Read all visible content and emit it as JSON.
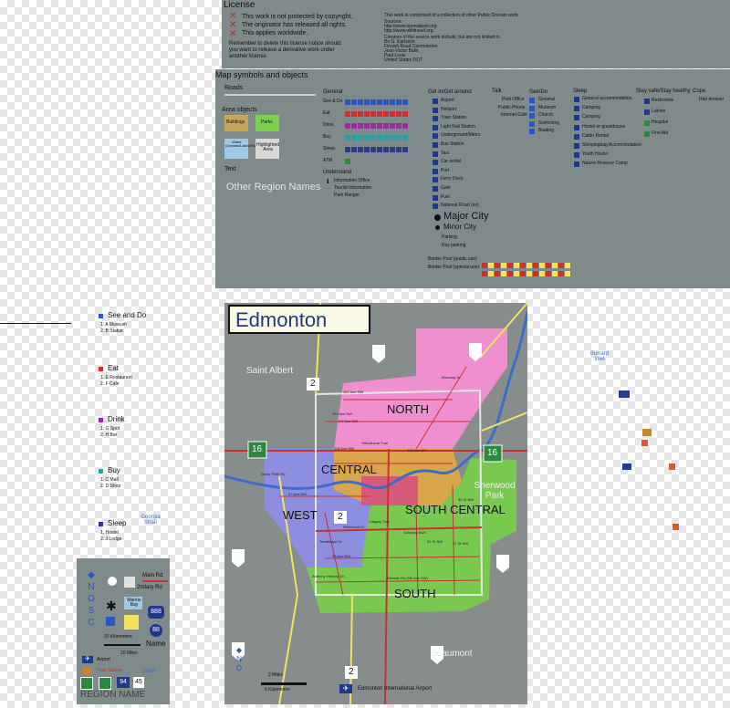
{
  "license": {
    "title": "License",
    "lines": [
      "This work is not protected by copyright.",
      "The originator has released all rights.",
      "This applies worldwide."
    ],
    "reminder": [
      "Remember to delete this license notice should",
      "you want to release a derivative work under",
      "another license."
    ],
    "credits": [
      "This work is comprised of a collection of other Public Domain work.",
      "Sources:",
      "http://www.openclipart.org",
      "http://www.wikitravel.org",
      "Creators of the source work include, but are not limited to",
      "Bo G. Karlsson",
      "Finnish Road Commission",
      "Jean-Victor Balin",
      "Paul Louis",
      "United States DOT"
    ]
  },
  "legend": {
    "title": "Map symbols and objects",
    "roads": "Roads",
    "area_objects": "Area objects",
    "areas": [
      {
        "label": "Buildings",
        "color": "#c8a35a"
      },
      {
        "label": "Parks",
        "color": "#7fd04a"
      },
      {
        "label": "Water (Oceans/Lakes/Rivers/Ponds)",
        "color": "#9ec8e6"
      },
      {
        "label": "Highlighted Area",
        "color": "#d8d8d8"
      }
    ],
    "text": "Text",
    "other_region": "Other Region Names",
    "general": {
      "title": "General",
      "rows": [
        {
          "label": "See & Do",
          "color": "#2a56c6",
          "count": 10
        },
        {
          "label": "Eat",
          "color": "#c83232",
          "count": 10
        },
        {
          "label": "Drink",
          "color": "#9b2c9b",
          "count": 10
        },
        {
          "label": "Buy",
          "color": "#2aa0a0",
          "count": 10
        },
        {
          "label": "Sleep",
          "color": "#2a3c8a",
          "count": 10
        },
        {
          "label": "ATM",
          "color": "#2a8a3c",
          "count": 1
        }
      ]
    },
    "understand": {
      "title": "Understand",
      "items": [
        "Information Office",
        "Tourist Information",
        "Park Ranger"
      ]
    },
    "getin": {
      "title": "Get in/Get around",
      "items": [
        "Airport",
        "Heliport",
        "Train Station",
        "Light Rail Station",
        "Underground/Metro",
        "Bus Station",
        "Taxi",
        "Car rental",
        "Port",
        "Ferry Dock",
        "Gate",
        "Fuel",
        "National Road (ex)"
      ],
      "major_city": "Major City",
      "minor_city": "Minor City",
      "parking": "Parking",
      "pay_parking": "Pay parking",
      "border_public": "Border Post (public use)",
      "border_special": "Border Post (special use)"
    },
    "talk": {
      "title": "Talk",
      "items": [
        "Post Office",
        "Public Phone",
        "Internet Cafe"
      ]
    },
    "seedo": {
      "title": "See/Do",
      "items": [
        "General",
        "Museum",
        "Church",
        "Swimming",
        "Boating"
      ]
    },
    "sleep": {
      "title": "Sleep",
      "items": [
        "General accommodation",
        "Camping",
        "Camping",
        "Hostel or guesthouse",
        "Cabin Rental",
        "Sleepingbag Accommodation",
        "Youth Hostel",
        "Nature Reserve Camp"
      ]
    },
    "staysafe": {
      "title": "Stay safe/Stay healthy",
      "items": [
        "Restrooms",
        "Latrine",
        "Hospital",
        "First Aid"
      ]
    },
    "cope": {
      "title": "Cope",
      "items": [
        "Hair dresser"
      ]
    }
  },
  "side_legend": [
    {
      "title": "See and Do",
      "color": "#2a56c6",
      "items": [
        "1. A Museum",
        "2. B Statue"
      ]
    },
    {
      "title": "Eat",
      "color": "#c83232",
      "items": [
        "1. E Restaurant",
        "2. F Cafe"
      ]
    },
    {
      "title": "Drink",
      "color": "#9b2c9b",
      "items": [
        "1. G Spot",
        "2. H Bar"
      ]
    },
    {
      "title": "Buy",
      "color": "#2aa0a0",
      "items": [
        "1. C Mall",
        "2. D Shop"
      ]
    },
    {
      "title": "Sleep",
      "color": "#2a3c8a",
      "items": [
        "1. Hostel",
        "2. J Lodge"
      ]
    }
  ],
  "labels": {
    "georgia_strait": "Georgia Strait",
    "burrard_inlet": "Burrard Inlet",
    "main_rd": "Main Rd",
    "secondary_rd": "2ndary Rd",
    "marine_bay": "Marine Bay",
    "name": "Name",
    "km20": "20 Kilometers",
    "mi20": "20 Miles",
    "river": "River",
    "airport": "Airport",
    "train_station": "Train Station",
    "region_name": "REGION NAME",
    "shield_888": "888",
    "shield_88": "88",
    "shield_94": "94",
    "shield_45": "45"
  },
  "map": {
    "title": "Edmonton",
    "regions": [
      "NORTH",
      "CENTRAL",
      "WEST",
      "SOUTH CENTRAL",
      "SOUTH"
    ],
    "places": [
      "Saint Albert",
      "Sherwood Park",
      "Beaumont"
    ],
    "airport": "Edmonton International Airport",
    "scale_miles": "2 Miles",
    "scale_km": "5 Kilometers",
    "shield_2": "2",
    "shield_16": "16",
    "roads": [
      "167 Ave NW",
      "153 Ave NW",
      "137 Ave NW",
      "Yellowhead Trail",
      "118 Ave NW",
      "118 Ave NW",
      "Stony Plain Rd",
      "87 Ave NW",
      "Whitemud Dr",
      "23 Ave NW",
      "Anthony Henday Dr",
      "Ellerslie Rd (9th Ave SW)",
      "Manning Dr",
      "Terwillegar Dr",
      "Calgary Trail",
      "Gateway Blvd",
      "91 St NW",
      "17 St NW",
      "50 St NW"
    ]
  }
}
